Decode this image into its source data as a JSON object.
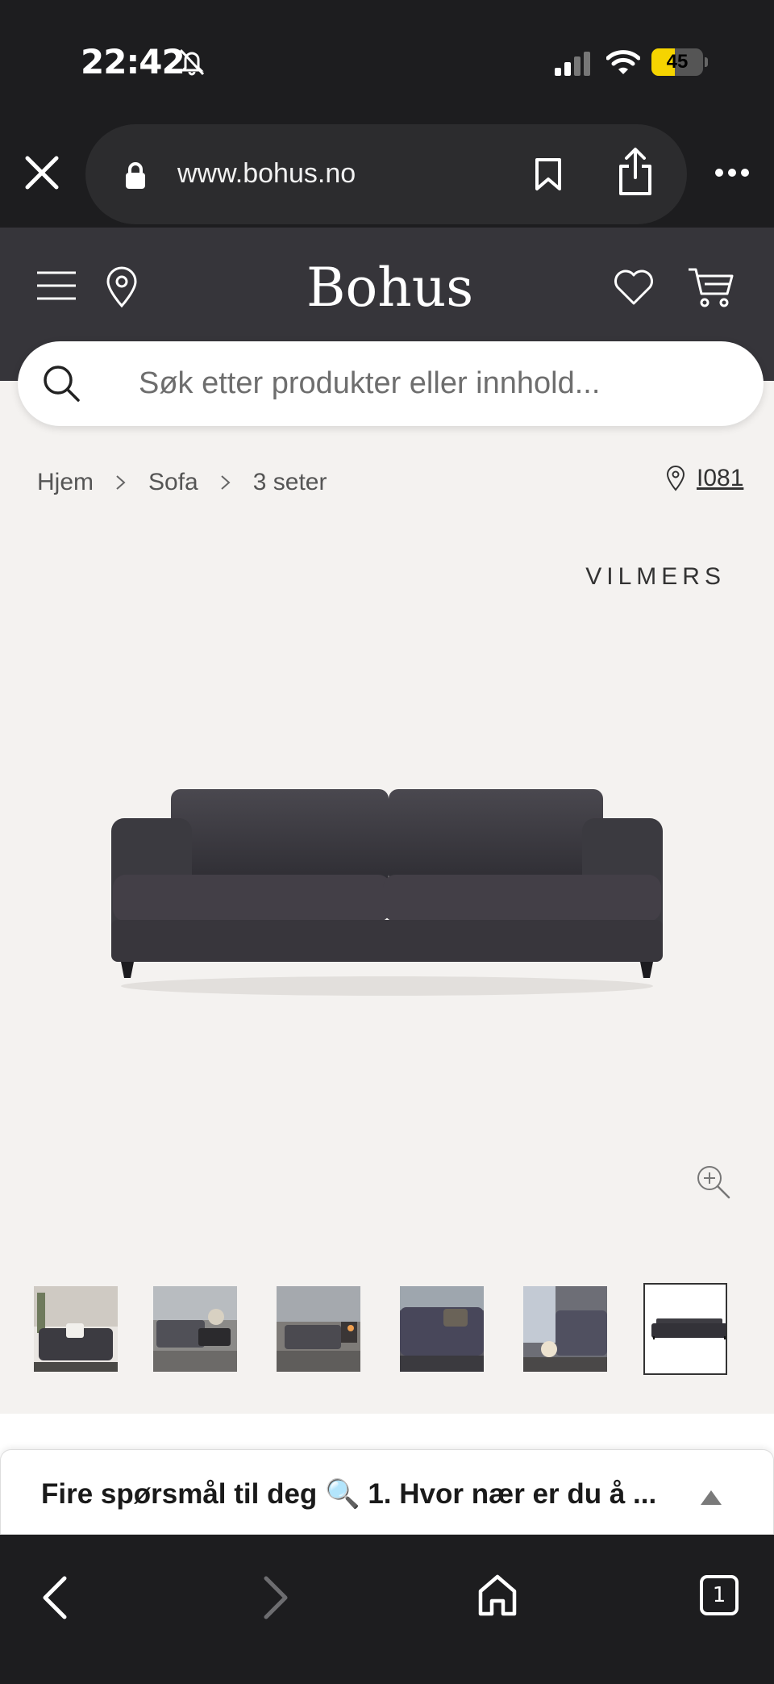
{
  "status_bar": {
    "time": "22:42",
    "battery_level": "45",
    "battery_fraction": 0.45,
    "icons": [
      "bell-slash-icon",
      "cellular-signal-icon",
      "wifi-icon",
      "battery-icon"
    ]
  },
  "browser": {
    "url": "www.bohus.no",
    "icons": [
      "close-icon",
      "lock-icon",
      "bookmark-icon",
      "share-icon",
      "more-icon"
    ]
  },
  "header": {
    "logo": "Bohus",
    "icons": [
      "menu-icon",
      "location-pin-icon",
      "heart-icon",
      "cart-icon"
    ]
  },
  "search": {
    "placeholder": "Søk etter produkter eller innhold..."
  },
  "breadcrumb": {
    "items": [
      "Hjem",
      "Sofa",
      "3 seter"
    ]
  },
  "store": {
    "label": "I081"
  },
  "product": {
    "brand": "VILMERS",
    "image": "dark-grey-3-seat-sofa",
    "thumbnails": [
      "living-room-sofa-1",
      "living-room-sofa-2",
      "living-room-sofa-3",
      "sofa-closeup-4",
      "sofa-side-5",
      "sofa-product-6"
    ],
    "active_thumbnail": 6
  },
  "chat": {
    "text": "Fire spørsmål til deg 🔍 1. Hvor nær er du å ..."
  },
  "toolbar": {
    "tab_count": "1",
    "icons": [
      "back-icon",
      "forward-icon",
      "home-icon",
      "tabs-icon"
    ]
  },
  "colors": {
    "header_bg": "#36353a",
    "page_bg": "#f4f2f0",
    "chrome_bg": "#1d1d1f",
    "battery_yellow": "#f5d400"
  }
}
